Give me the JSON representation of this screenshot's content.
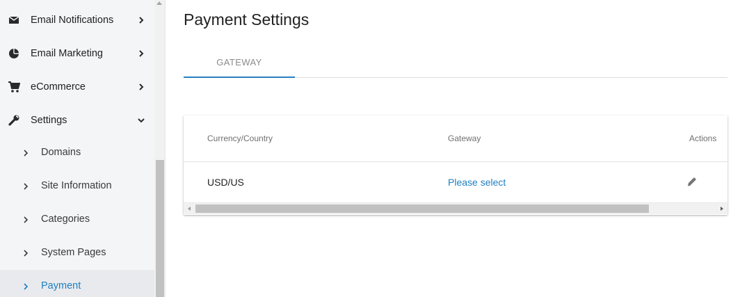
{
  "sidebar": {
    "items": [
      {
        "label": "Email Notifications",
        "icon": "envelope-icon"
      },
      {
        "label": "Email Marketing",
        "icon": "pie-chart-icon"
      },
      {
        "label": "eCommerce",
        "icon": "cart-icon"
      },
      {
        "label": "Settings",
        "icon": "wrench-icon",
        "expanded": true
      }
    ],
    "sub_items": [
      {
        "label": "Domains"
      },
      {
        "label": "Site Information"
      },
      {
        "label": "Categories"
      },
      {
        "label": "System Pages"
      },
      {
        "label": "Payment",
        "active": true
      }
    ]
  },
  "page": {
    "title": "Payment Settings",
    "tabs": [
      {
        "label": "GATEWAY",
        "active": true
      }
    ]
  },
  "table": {
    "columns": [
      "Currency/Country",
      "Gateway",
      "Actions"
    ],
    "rows": [
      {
        "currency_country": "USD/US",
        "gateway": "Please select"
      }
    ]
  },
  "colors": {
    "accent": "#1e7fc1",
    "sidebar_bg": "#f4f5f7",
    "active_bg": "#e9eaee"
  }
}
